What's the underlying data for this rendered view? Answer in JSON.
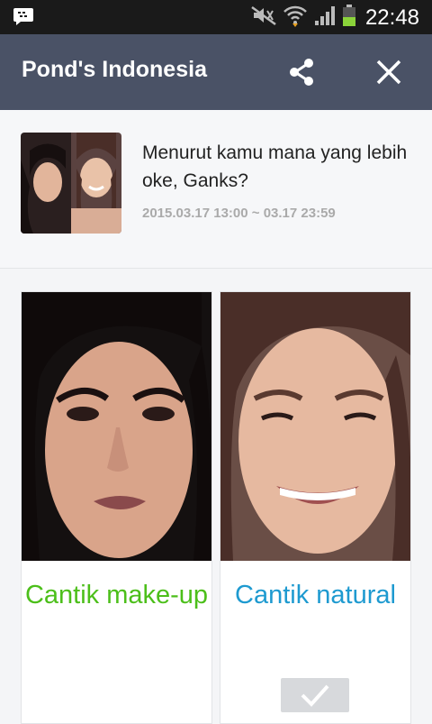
{
  "status_bar": {
    "time": "22:48",
    "icons": [
      "bbm-chat-icon",
      "mute-icon",
      "wifi-icon",
      "signal-icon",
      "battery-icon"
    ]
  },
  "header": {
    "title": "Pond's Indonesia",
    "share_icon": "share-icon",
    "close_icon": "close-icon",
    "background": "#4a5266"
  },
  "post": {
    "title": "Menurut kamu mana yang lebih oke, Ganks?",
    "date_range": "2015.03.17 13:00 ~ 03.17 23:59"
  },
  "options": [
    {
      "label": "Cantik make-up",
      "color": "#4cbf1a"
    },
    {
      "label": "Cantik natural",
      "color": "#1e9ad0",
      "selected": true
    }
  ]
}
